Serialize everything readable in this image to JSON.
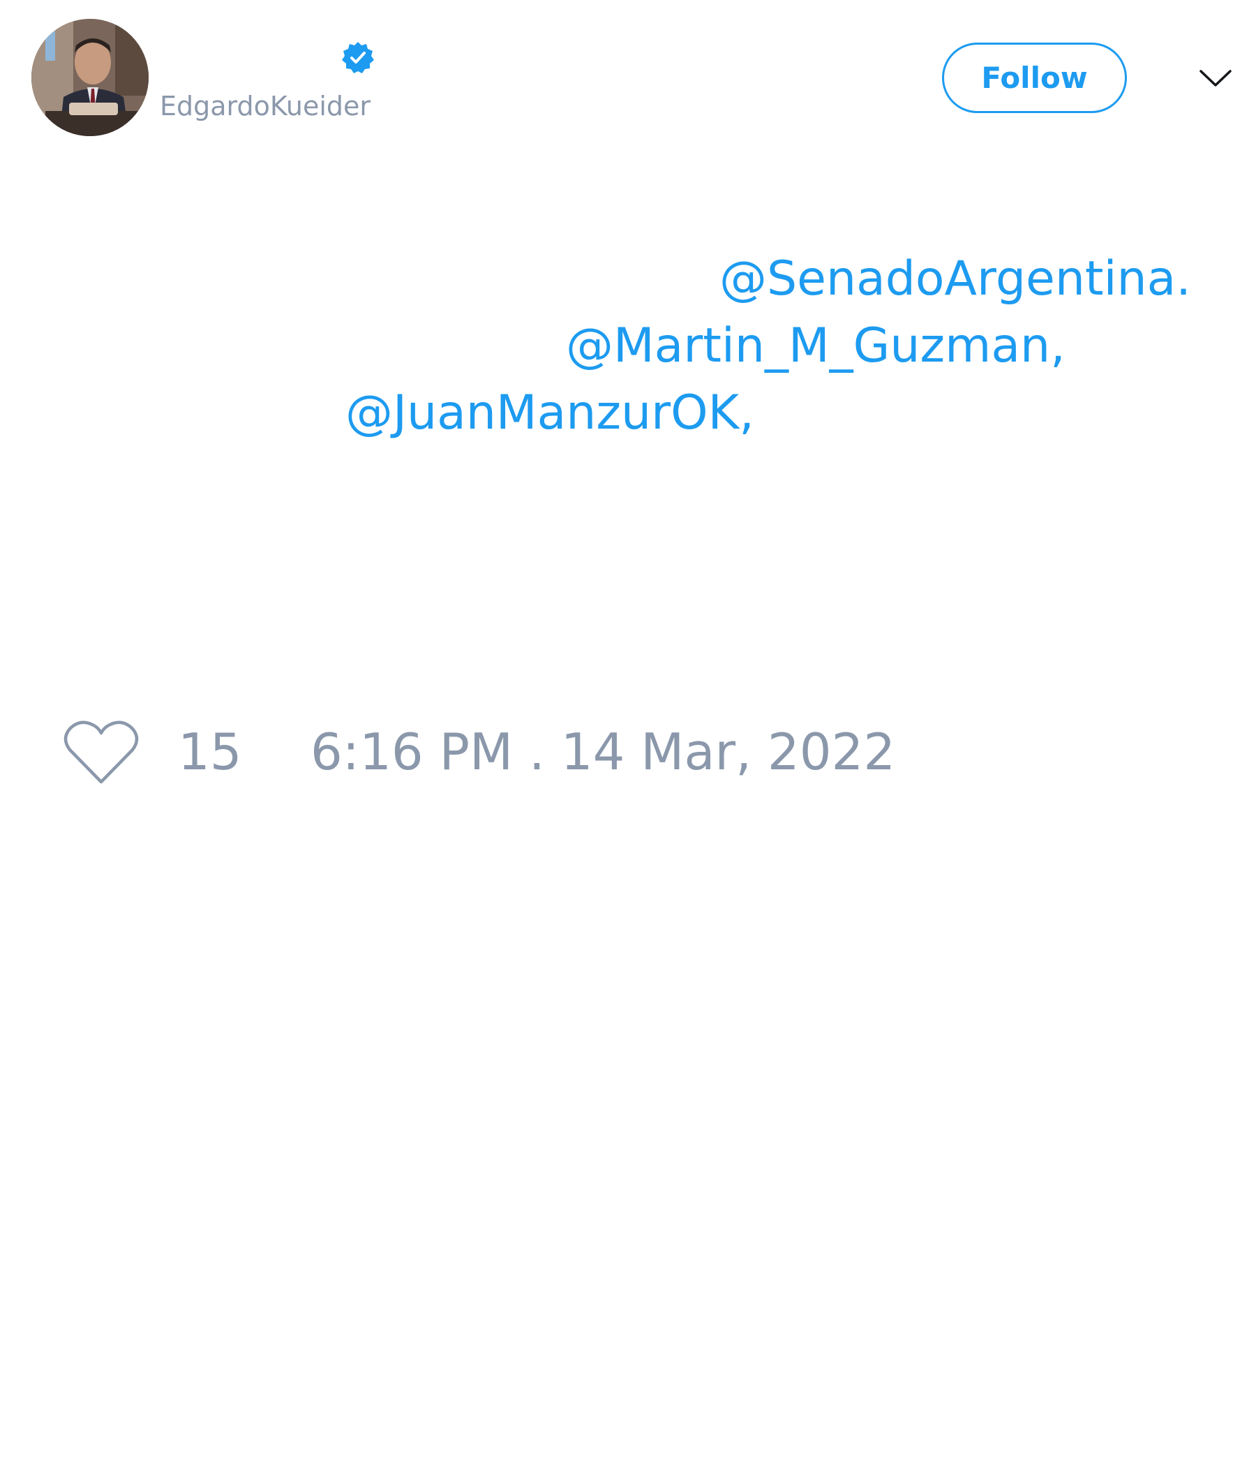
{
  "tweet": {
    "author": {
      "display_name": "",
      "username": "EdgardoKueider",
      "verified": true,
      "avatar_icon": "profile-photo"
    },
    "follow_label": "Follow",
    "menu_icon": "chevron-down-icon",
    "mentions": [
      "@SenadoArgentina.",
      "@Martin_M_Guzman,",
      "@JuanManzurOK,"
    ],
    "like_icon": "heart-outline-icon",
    "like_count": "15",
    "timestamp": "6:16 PM . 14 Mar, 2022"
  },
  "colors": {
    "accent": "#1d9bf0",
    "secondary_text": "#8b98ab",
    "background": "#ffffff"
  }
}
